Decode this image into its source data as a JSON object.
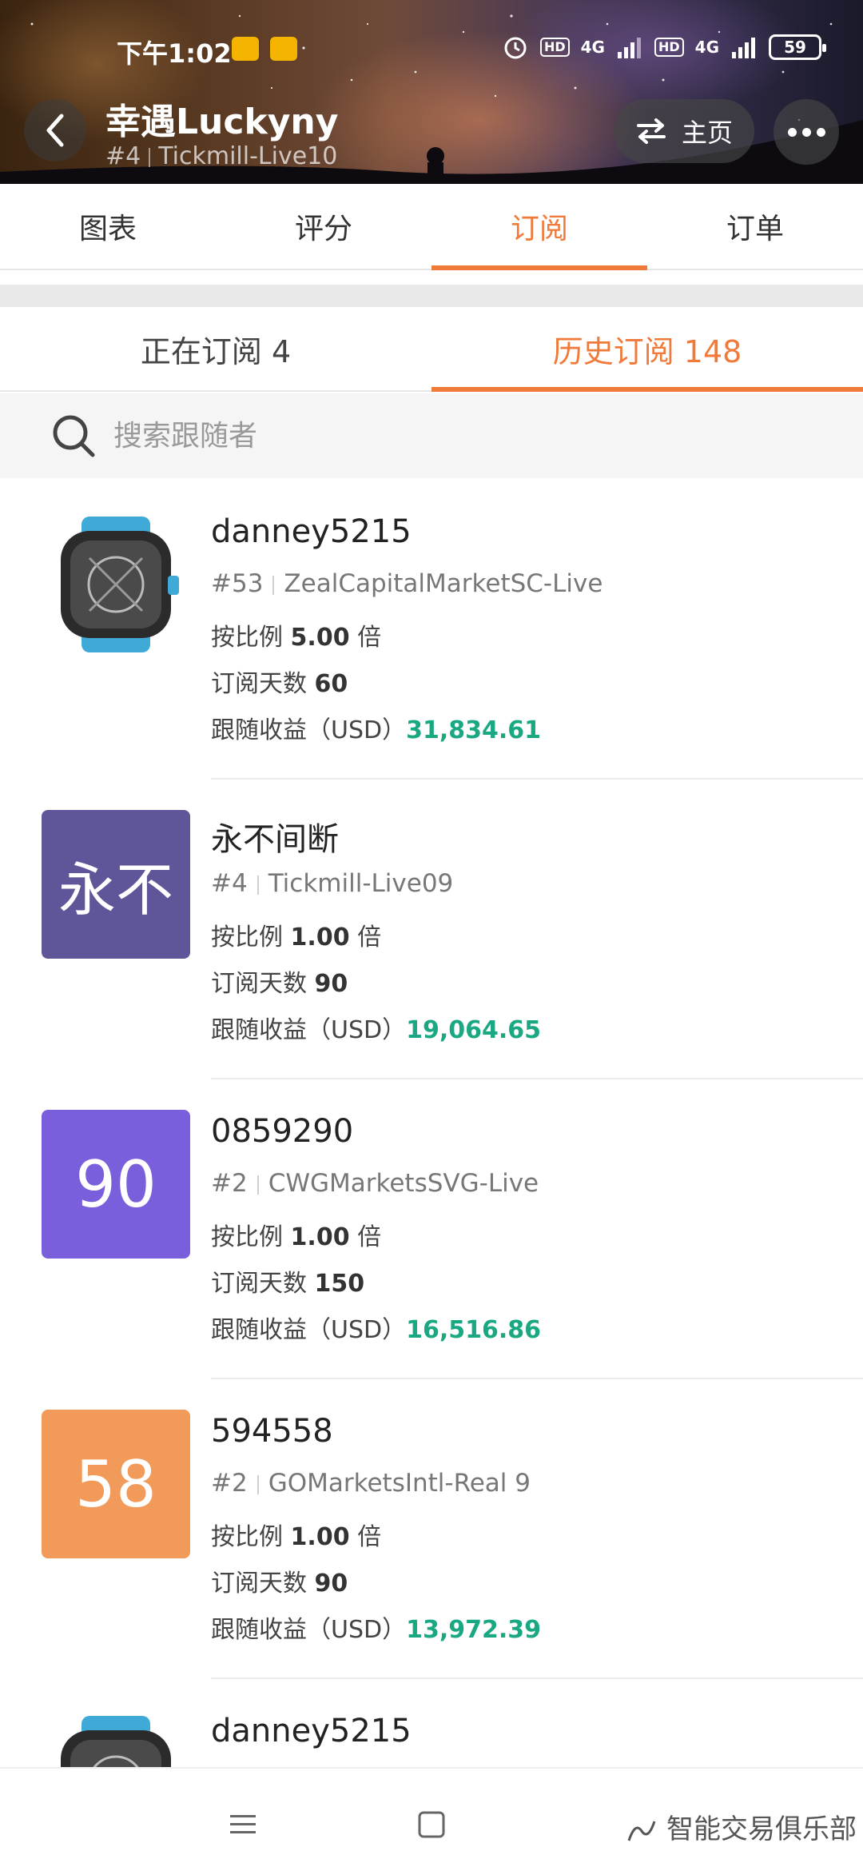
{
  "status_bar": {
    "time": "下午1:02",
    "network_1": "4G",
    "network_2": "4G",
    "hd_1": "HD",
    "hd_2": "HD",
    "battery": "59"
  },
  "header": {
    "title": "幸遇Luckyny",
    "rank": "#4",
    "server": "Tickmill-Live10",
    "home_label": "主页"
  },
  "main_tabs": [
    {
      "label": "图表"
    },
    {
      "label": "评分"
    },
    {
      "label": "订阅",
      "active": true
    },
    {
      "label": "订单"
    }
  ],
  "sub_tabs": [
    {
      "label": "正在订阅 4"
    },
    {
      "label": "历史订阅 148",
      "active": true
    }
  ],
  "search": {
    "placeholder": "搜索跟随者"
  },
  "labels": {
    "ratio_prefix": "按比例 ",
    "ratio_suffix": " 倍",
    "days_prefix": "订阅天数 ",
    "profit_prefix": "跟随收益（USD）"
  },
  "followers": [
    {
      "name": "danney5215",
      "rank": "#53",
      "server": "ZealCapitalMarketSC-Live",
      "ratio": "5.00",
      "days": "60",
      "profit": "31,834.61",
      "avatar_type": "watch",
      "avatar_text": ""
    },
    {
      "name": "永不间断",
      "rank": "#4",
      "server": "Tickmill-Live09",
      "ratio": "1.00",
      "days": "90",
      "profit": "19,064.65",
      "avatar_type": "text",
      "avatar_text": "永不",
      "avatar_color": "#5e5699"
    },
    {
      "name": "0859290",
      "rank": "#2",
      "server": "CWGMarketsSVG-Live",
      "ratio": "1.00",
      "days": "150",
      "profit": "16,516.86",
      "avatar_type": "text",
      "avatar_text": "90",
      "avatar_color": "#7a5fdc"
    },
    {
      "name": "594558",
      "rank": "#2",
      "server": "GOMarketsIntl-Real 9",
      "ratio": "1.00",
      "days": "90",
      "profit": "13,972.39",
      "avatar_type": "text",
      "avatar_text": "58",
      "avatar_color": "#f29a5a"
    },
    {
      "name": "danney5215",
      "avatar_type": "watch",
      "avatar_text": ""
    }
  ],
  "watermark": "智能交易俱乐部",
  "colors": {
    "accent": "#f07a3a",
    "profit": "#1aa882"
  }
}
